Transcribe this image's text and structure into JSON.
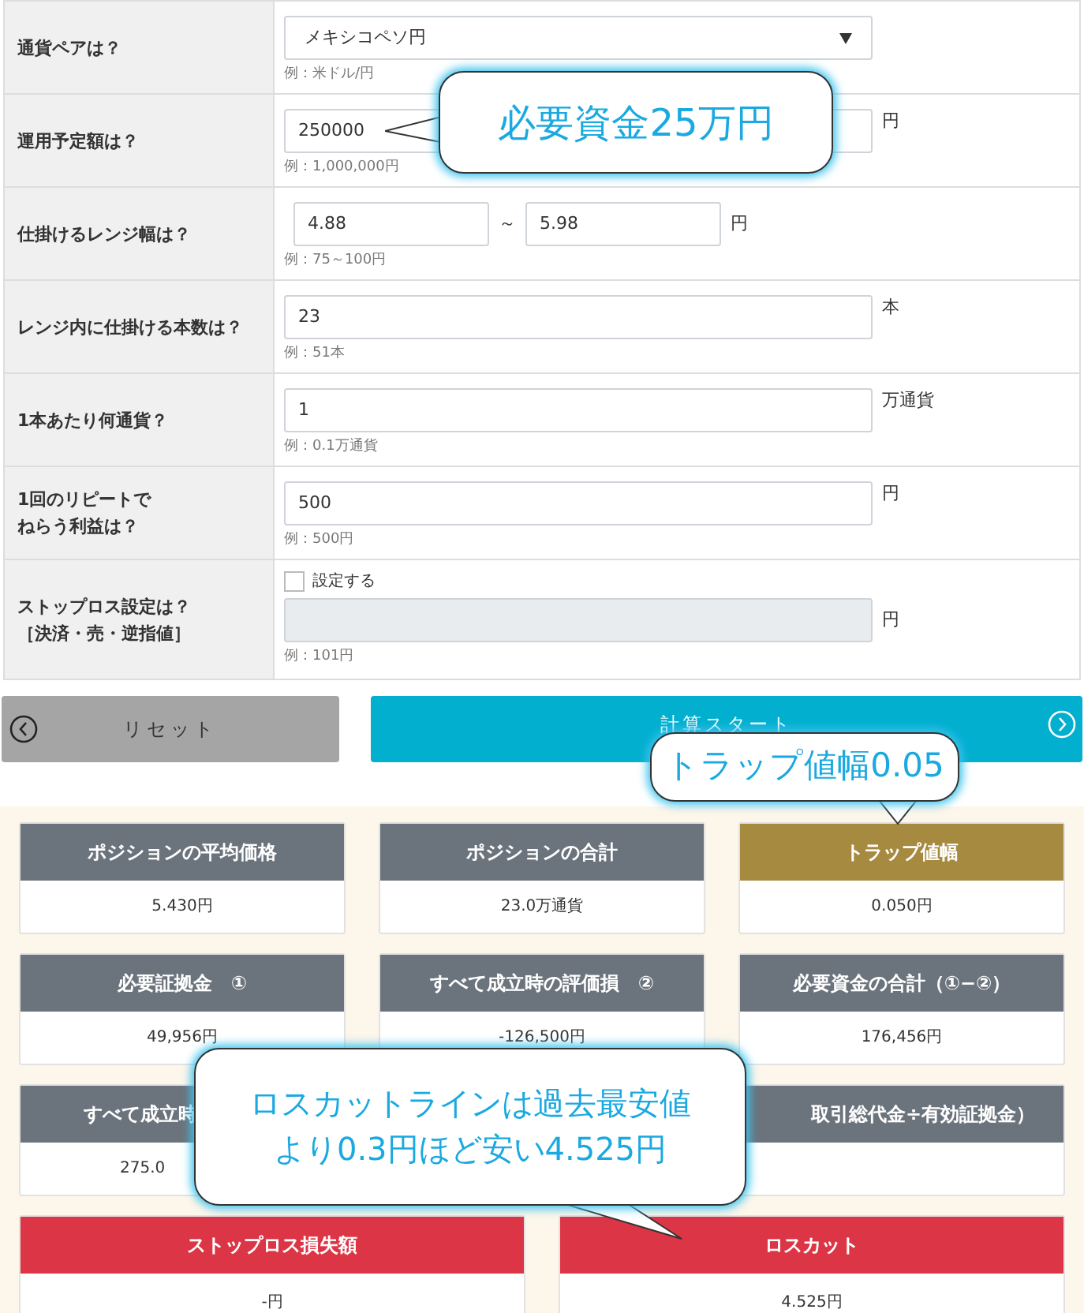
{
  "form": [
    {
      "label": "通貨ペアは？",
      "kind": "select",
      "value": "メキシコペソ円",
      "hint": "例：米ドル/円"
    },
    {
      "label": "運用予定額は？",
      "kind": "text",
      "value": "250000",
      "unit": "円",
      "hint": "例：1,000,000円"
    },
    {
      "label": "仕掛けるレンジ幅は？",
      "kind": "range",
      "value": "4.88",
      "separator": "～",
      "value2": "5.98",
      "unit": "円",
      "hint": "例：75～100円"
    },
    {
      "label": "レンジ内に仕掛ける本数は？",
      "kind": "text",
      "value": "23",
      "unit": "本",
      "hint": "例：51本"
    },
    {
      "label": "1本あたり何通貨？",
      "kind": "text",
      "value": "1",
      "unit": "万通貨",
      "hint": "例：0.1万通貨"
    },
    {
      "label": [
        "1回のリピートで",
        "ねらう利益は？"
      ],
      "kind": "text",
      "value": "500",
      "unit": "円",
      "hint": "例：500円"
    },
    {
      "label": [
        "ストップロス設定は？",
        "［決済・売・逆指値］"
      ],
      "kind": "checkbox",
      "checkbox_label": "設定する",
      "checked": false,
      "disabled": true,
      "unit": "円",
      "hint": "例：101円"
    }
  ],
  "buttons": [
    {
      "label": "リセット",
      "kind": "reset"
    },
    {
      "label": "計算スタート",
      "kind": "start"
    }
  ],
  "results": [
    {
      "title": "ポジションの平均価格",
      "value": "5.430円",
      "color": "#6b737c"
    },
    {
      "title": "ポジションの合計",
      "value": "23.0万通貨",
      "color": "#6b737c"
    },
    {
      "title": "トラップ値幅",
      "value": "0.050円",
      "color": "#a68a40"
    },
    {
      "title": "必要証拠金　①",
      "value": "49,956円",
      "color": "#6b737c"
    },
    {
      "title": "すべて成立時の評価損　②",
      "value": "-126,500円",
      "color": "#6b737c"
    },
    {
      "title": "必要資金の合計（①−②）",
      "value": "176,456円",
      "color": "#6b737c"
    },
    {
      "title": "すべて成立時",
      "value": "275.0",
      "color": "#6b737c",
      "kind": "cut-end"
    },
    {
      "title": "取引総代金÷有効証拠金）",
      "color": "#6b737c",
      "kind": "cut-start"
    }
  ],
  "results_bottom": [
    {
      "title": "ストップロス損失額",
      "value": "-円",
      "color": "#dc3545"
    },
    {
      "title": "ロスカット",
      "value": "4.525円",
      "color": "#dc3545"
    }
  ],
  "callouts": [
    {
      "text": "必要資金25万円",
      "kind": "left"
    },
    {
      "text": "トラップ値幅0.05",
      "kind": "down"
    },
    {
      "text": [
        "ロスカットラインは過去最安値",
        "より0.3円ほど安い4.525円"
      ],
      "kind": "down-right"
    }
  ]
}
